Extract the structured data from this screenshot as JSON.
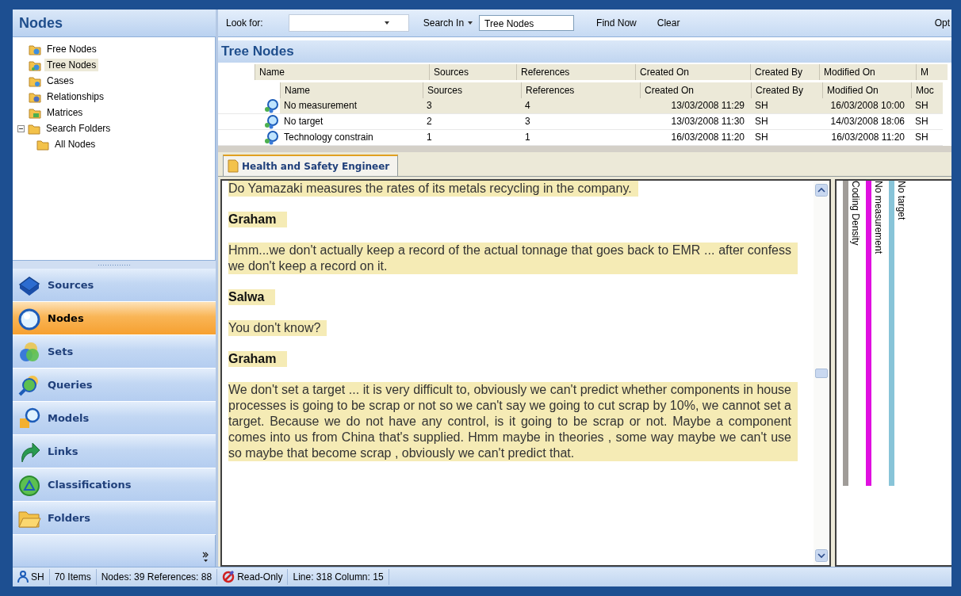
{
  "sidebar": {
    "title": "Nodes",
    "tree": [
      {
        "label": "Free Nodes",
        "selected": false
      },
      {
        "label": "Tree Nodes",
        "selected": true
      },
      {
        "label": "Cases",
        "selected": false
      },
      {
        "label": "Relationships",
        "selected": false
      },
      {
        "label": "Matrices",
        "selected": false
      },
      {
        "label": "Search Folders",
        "selected": false,
        "expanded": true,
        "children": [
          {
            "label": "All Nodes",
            "selected": false
          }
        ]
      }
    ],
    "nav": [
      {
        "label": "Sources",
        "selected": false
      },
      {
        "label": "Nodes",
        "selected": true
      },
      {
        "label": "Sets",
        "selected": false
      },
      {
        "label": "Queries",
        "selected": false
      },
      {
        "label": "Models",
        "selected": false
      },
      {
        "label": "Links",
        "selected": false
      },
      {
        "label": "Classifications",
        "selected": false
      },
      {
        "label": "Folders",
        "selected": false
      }
    ]
  },
  "search_bar": {
    "label": "Look for:",
    "search_in": "Search In",
    "scope": "Tree Nodes",
    "buttons": [
      "Find Now",
      "Clear",
      "Opt"
    ]
  },
  "list": {
    "title": "Tree Nodes",
    "outer_columns": [
      "Name",
      "Sources",
      "References",
      "Created On",
      "Created By",
      "Modified On",
      "M"
    ],
    "columns": [
      "Name",
      "Sources",
      "References",
      "Created On",
      "Created By",
      "Modified On",
      "Moc"
    ],
    "rows": [
      {
        "selected": true,
        "cells": [
          "No measurement",
          "3",
          "4",
          "13/03/2008 11:29",
          "SH",
          "16/03/2008 10:00",
          "SH"
        ]
      },
      {
        "selected": false,
        "cells": [
          "No target",
          "2",
          "3",
          "13/03/2008 11:30",
          "SH",
          "14/03/2008 18:06",
          "SH"
        ]
      },
      {
        "selected": false,
        "cells": [
          "Technology constrain",
          "1",
          "1",
          "16/03/2008 11:20",
          "SH",
          "16/03/2008 11:20",
          "SH"
        ]
      }
    ]
  },
  "document": {
    "tab": {
      "label": "Health and Safety Engineer",
      "selected": true
    },
    "paragraphs": [
      {
        "kind": "speech",
        "text": "Do Yamazaki measures the rates of its metals recycling in the company."
      },
      {
        "kind": "speaker",
        "text": "Graham"
      },
      {
        "kind": "speech",
        "text": "Hmm...we don't actually keep a record of the actual tonnage that goes back to EMR ... after confess we don't keep a record on it."
      },
      {
        "kind": "speaker",
        "text": "Salwa"
      },
      {
        "kind": "speech",
        "text": "You don't know?"
      },
      {
        "kind": "speaker",
        "text": "Graham"
      },
      {
        "kind": "speech",
        "text": "We don't set a target ... it is very difficult to, obviously we can't predict whether components in house processes is going to be scrap or not so we can't say we going to cut scrap by 10%, we cannot set a target. Because we do not have any control, is it going to be scrap or not. Maybe a component comes into us from China that's supplied. Hmm maybe in theories , some way maybe we can't use so maybe that become scrap , obviously we can't predict that."
      }
    ]
  },
  "coding_stripes": [
    {
      "label": "Coding Density",
      "color": "#a09c98"
    },
    {
      "label": "No measurement",
      "color": "#e010e0"
    },
    {
      "label": "No target",
      "color": "#88c4d8"
    }
  ],
  "status_bar": {
    "user": "SH",
    "items": "70 Items",
    "counts": "Nodes: 39 References: 88",
    "mode": "Read-Only",
    "position": "Line: 318 Column: 15"
  }
}
